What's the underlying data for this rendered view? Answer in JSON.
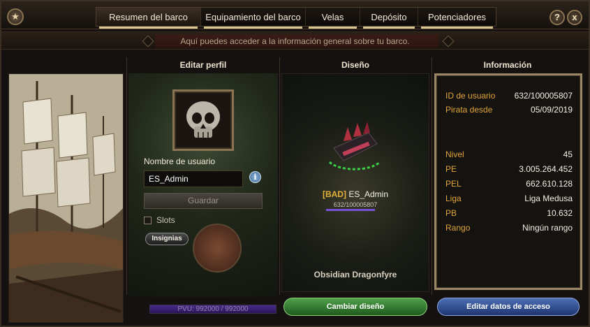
{
  "tabs": [
    {
      "label": "Resumen del barco",
      "active": true
    },
    {
      "label": "Equipamiento del barco",
      "active": false
    },
    {
      "label": "Velas",
      "active": false
    },
    {
      "label": "Depósito",
      "active": false
    },
    {
      "label": "Potenciadores",
      "active": false
    }
  ],
  "top_buttons": {
    "help": "?",
    "close": "x",
    "star": "★"
  },
  "banner": "Aquí puedes acceder a la información general sobre tu barco.",
  "columns": {
    "profile": "Editar perfil",
    "design": "Diseño",
    "info": "Información"
  },
  "profile": {
    "username_label": "Nombre de usuario",
    "username_value": "ES_Admin",
    "save_label": "Guardar",
    "slots_label": "Slots",
    "slots_checked": false,
    "badges_label": "Insignias",
    "hp_text": "PVU: 992000 / 992000",
    "hp_fraction": 1.0
  },
  "design": {
    "tag": "[BAD]",
    "name": "ES_Admin",
    "id": "632/100005807",
    "ship_name": "Obsidian Dragonfyre",
    "change_label": "Cambiar diseño"
  },
  "info": {
    "rows": [
      {
        "key": "ID de usuario",
        "value": "632/100005807"
      },
      {
        "key": "Pirata desde",
        "value": "05/09/2019"
      },
      {
        "key": "Nivel",
        "value": "45"
      },
      {
        "key": "PE",
        "value": "3.005.264.452"
      },
      {
        "key": "PEL",
        "value": "662.610.128"
      },
      {
        "key": "Liga",
        "value": "Liga Medusa"
      },
      {
        "key": "PB",
        "value": "10.632"
      },
      {
        "key": "Rango",
        "value": "Ningún rango"
      }
    ],
    "edit_label": "Editar datos de acceso"
  },
  "colors": {
    "accent_gold": "#e0a43a",
    "change_button": "#2f7a2b",
    "edit_button": "#2d4a8e",
    "hp_bar": "#4a2a8a"
  },
  "icons": [
    "star-icon",
    "help-icon",
    "close-icon",
    "skull-icon",
    "info-icon",
    "ship-icon"
  ]
}
